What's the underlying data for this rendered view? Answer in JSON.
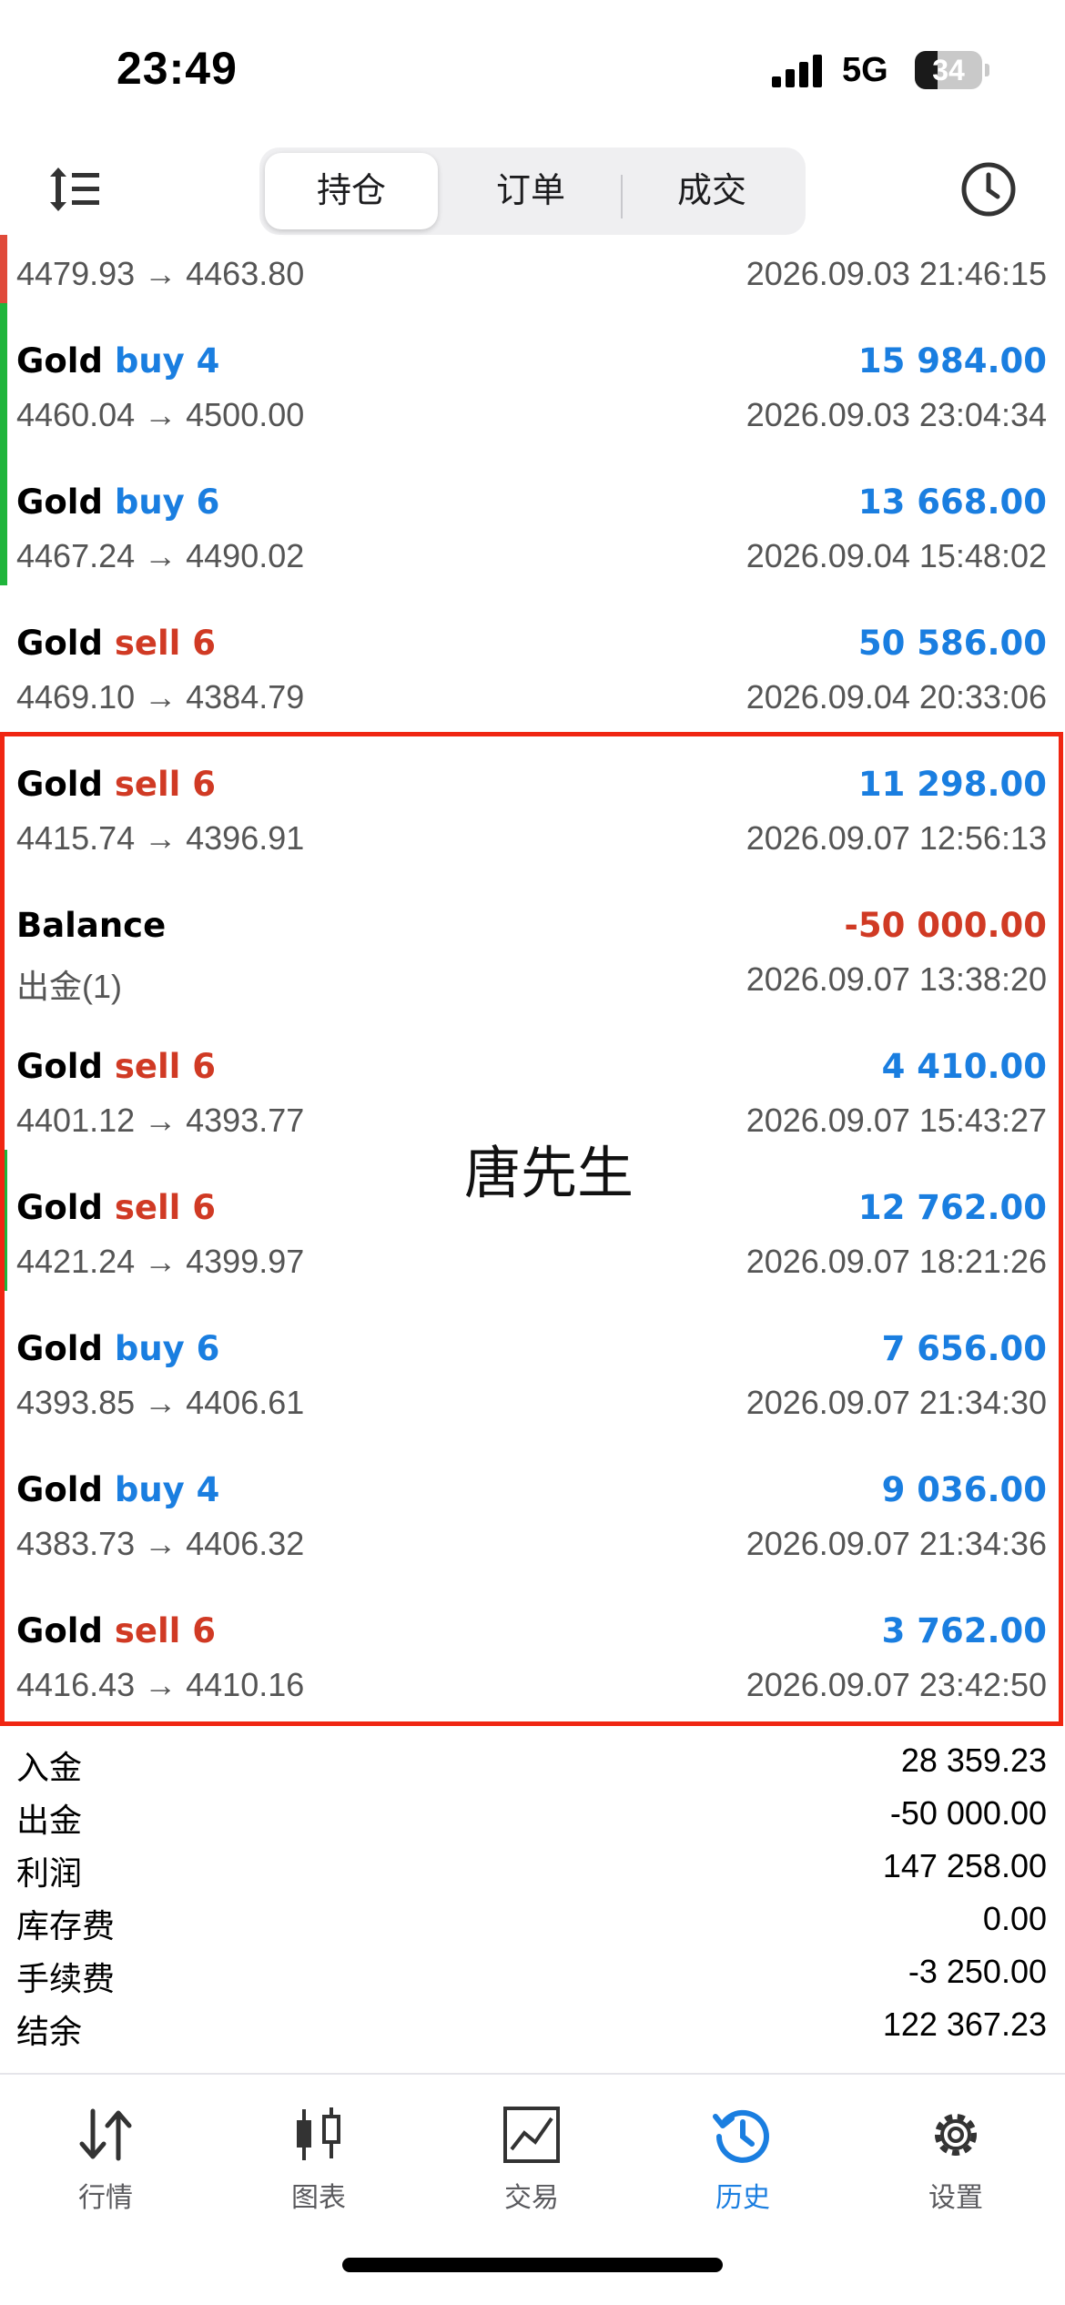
{
  "status_bar": {
    "time": "23:49",
    "network": "5G",
    "battery": "34",
    "battery_level": 0.34
  },
  "toolbar": {
    "tabs": [
      {
        "label": "持仓",
        "active": true
      },
      {
        "label": "订单",
        "active": false
      },
      {
        "label": "成交",
        "active": false
      }
    ]
  },
  "colors": {
    "accent_blue": "#1a7ee0",
    "sell_red": "#d03a24",
    "highlight_red": "#f02612",
    "bar_green": "#1fb53b"
  },
  "deals": [
    {
      "symbol": "",
      "side": "",
      "prices": "4479.93 → 4463.80",
      "profit": "",
      "time": "2026.09.03 21:46:15",
      "bar": "red"
    },
    {
      "symbol": "Gold",
      "side": "buy 4",
      "prices": "4460.04 → 4500.00",
      "profit": "15 984.00",
      "time": "2026.09.03 23:04:34",
      "bar": "green"
    },
    {
      "symbol": "Gold",
      "side": "buy 6",
      "prices": "4467.24 → 4490.02",
      "profit": "13 668.00",
      "time": "2026.09.04 15:48:02",
      "bar": "green"
    },
    {
      "symbol": "Gold",
      "side": "sell 6",
      "prices": "4469.10 → 4384.79",
      "profit": "50 586.00",
      "time": "2026.09.04 20:33:06",
      "bar": ""
    },
    {
      "symbol": "Gold",
      "side": "sell 6",
      "prices": "4415.74 → 4396.91",
      "profit": "11 298.00",
      "time": "2026.09.07 12:56:13",
      "bar": ""
    },
    {
      "symbol": "Balance",
      "side": "",
      "prices": "出金(1)",
      "profit": "-50 000.00",
      "time": "2026.09.07 13:38:20",
      "bar": ""
    },
    {
      "symbol": "Gold",
      "side": "sell 6",
      "prices": "4401.12 → 4393.77",
      "profit": "4 410.00",
      "time": "2026.09.07 15:43:27",
      "bar": ""
    },
    {
      "symbol": "Gold",
      "side": "sell 6",
      "prices": "4421.24 → 4399.97",
      "profit": "12 762.00",
      "time": "2026.09.07 18:21:26",
      "bar": "green"
    },
    {
      "symbol": "Gold",
      "side": "buy 6",
      "prices": "4393.85 → 4406.61",
      "profit": "7 656.00",
      "time": "2026.09.07 21:34:30",
      "bar": ""
    },
    {
      "symbol": "Gold",
      "side": "buy 4",
      "prices": "4383.73 → 4406.32",
      "profit": "9 036.00",
      "time": "2026.09.07 21:34:36",
      "bar": ""
    },
    {
      "symbol": "Gold",
      "side": "sell 6",
      "prices": "4416.43 → 4410.16",
      "profit": "3 762.00",
      "time": "2026.09.07 23:42:50",
      "bar": ""
    }
  ],
  "watermark": "唐先生",
  "summary": [
    {
      "label": "入金",
      "value": "28 359.23"
    },
    {
      "label": "出金",
      "value": "-50 000.00"
    },
    {
      "label": "利润",
      "value": "147 258.00"
    },
    {
      "label": "库存费",
      "value": "0.00"
    },
    {
      "label": "手续费",
      "value": "-3 250.00"
    },
    {
      "label": "结余",
      "value": "122 367.23"
    }
  ],
  "tabbar": [
    {
      "label": "行情",
      "icon": "quotes-arrows-icon",
      "active": false
    },
    {
      "label": "图表",
      "icon": "candlestick-chart-icon",
      "active": false
    },
    {
      "label": "交易",
      "icon": "trade-chart-icon",
      "active": false
    },
    {
      "label": "历史",
      "icon": "history-clock-icon",
      "active": true
    },
    {
      "label": "设置",
      "icon": "gear-icon",
      "active": false
    }
  ]
}
